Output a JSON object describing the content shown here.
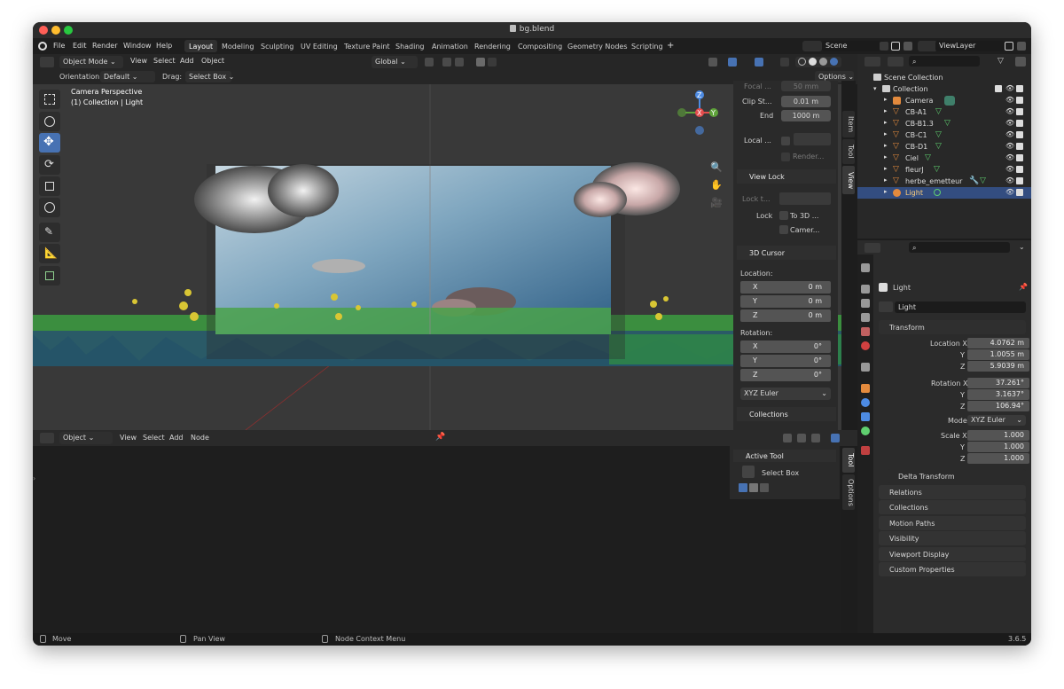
{
  "window": {
    "title": "bg.blend"
  },
  "menu": [
    "File",
    "Edit",
    "Render",
    "Window",
    "Help"
  ],
  "workspaces": {
    "active": "Layout",
    "tabs": [
      "Layout",
      "Modeling",
      "Sculpting",
      "UV Editing",
      "Texture Paint",
      "Shading",
      "Animation",
      "Rendering",
      "Compositing",
      "Geometry Nodes",
      "Scripting"
    ],
    "add": "+"
  },
  "scene": {
    "name": "Scene",
    "view_layer": "ViewLayer"
  },
  "header3d": {
    "mode": "Object Mode",
    "menus": [
      "View",
      "Select",
      "Add",
      "Object"
    ],
    "transform_space": "Global",
    "orientation_label": "Orientation:",
    "orientation_value": "Default",
    "drag_label": "Drag:",
    "drag_value": "Select Box",
    "options": "Options"
  },
  "viewport": {
    "line1": "Camera Perspective",
    "line2": "(1) Collection | Light",
    "gizmo": {
      "x": "X",
      "y": "Y",
      "z": "Z"
    }
  },
  "npanel": {
    "tabs": [
      "Item",
      "Tool",
      "View"
    ],
    "active_tab": "View",
    "focal_label": "Focal ...",
    "focal_value": "50 mm",
    "clip_start_label": "Clip St...",
    "clip_start_value": "0.01 m",
    "clip_end_label": "End",
    "clip_end_value": "1000 m",
    "local_label": "Local ...",
    "render_label": "Render...",
    "view_lock_title": "View Lock",
    "lock_to_label": "Lock t...",
    "lock_label": "Lock",
    "to_3d_label": "To 3D ...",
    "camera_label": "Camer...",
    "cursor_title": "3D Cursor",
    "location_label": "Location:",
    "loc": [
      {
        "axis": "X",
        "value": "0 m"
      },
      {
        "axis": "Y",
        "value": "0 m"
      },
      {
        "axis": "Z",
        "value": "0 m"
      }
    ],
    "rotation_label": "Rotation:",
    "rot": [
      {
        "axis": "X",
        "value": "0°"
      },
      {
        "axis": "Y",
        "value": "0°"
      },
      {
        "axis": "Z",
        "value": "0°"
      }
    ],
    "rotation_mode": "XYZ Euler",
    "collections_title": "Collections"
  },
  "outliner": {
    "root": "Scene Collection",
    "collection": "Collection",
    "items": [
      "Camera",
      "CB-A1",
      "CB-B1.3",
      "CB-C1",
      "CB-D1",
      "Ciel",
      "fleurJ",
      "herbe_emetteur",
      "Light"
    ],
    "selected": "Light"
  },
  "properties": {
    "object_name": "Light",
    "data_name": "Light",
    "transform_title": "Transform",
    "location_x_label": "Location X",
    "location": [
      "4.0762 m",
      "1.0055 m",
      "5.9039 m"
    ],
    "rotation_x_label": "Rotation X",
    "rotation": [
      "37.261°",
      "3.1637°",
      "106.94°"
    ],
    "axis_y": "Y",
    "axis_z": "Z",
    "mode_label": "Mode",
    "mode_value": "XYZ Euler",
    "scale_x_label": "Scale X",
    "scale": [
      "1.000",
      "1.000",
      "1.000"
    ],
    "delta_transform": "Delta Transform",
    "sections": [
      "Relations",
      "Collections",
      "Motion Paths",
      "Visibility",
      "Viewport Display",
      "Custom Properties"
    ]
  },
  "node_editor": {
    "editor_type": "Object",
    "menus": [
      "View",
      "Select",
      "Add",
      "Node"
    ],
    "tabs": [
      "Tool",
      "Options"
    ],
    "active_tool_title": "Active Tool",
    "active_tool_name": "Select Box"
  },
  "statusbar": {
    "items": [
      "Move",
      "Pan View",
      "Node Context Menu"
    ],
    "version": "3.6.5"
  },
  "colors": {
    "accent": "#4772b3",
    "selection": "#334d80",
    "object_orange": "#e38a3d",
    "mesh_green": "#66cc66",
    "traffic_red": "#ff5f57",
    "traffic_yellow": "#febc2e",
    "traffic_green": "#28c840"
  }
}
